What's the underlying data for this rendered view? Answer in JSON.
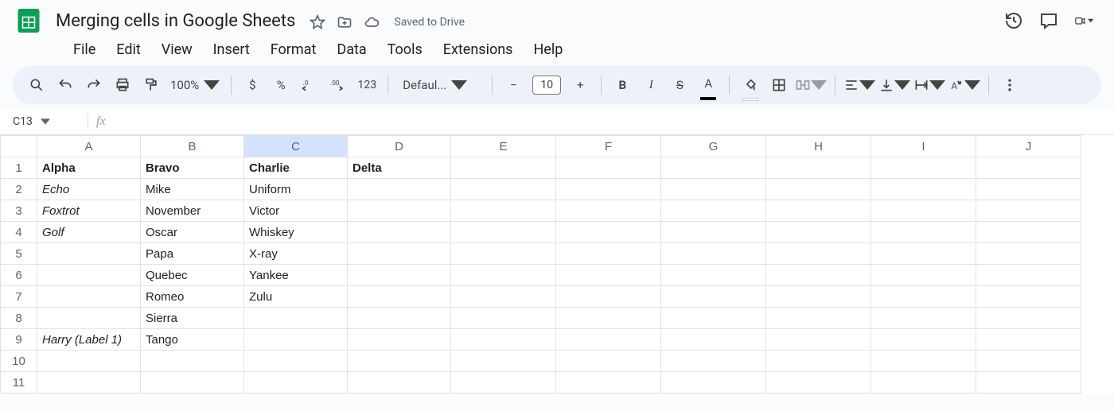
{
  "doc": {
    "title": "Merging cells in Google Sheets",
    "saved": "Saved to Drive"
  },
  "menu": {
    "file": "File",
    "edit": "Edit",
    "view": "View",
    "insert": "Insert",
    "format": "Format",
    "data": "Data",
    "tools": "Tools",
    "extensions": "Extensions",
    "help": "Help"
  },
  "toolbar": {
    "zoom": "100%",
    "currency": "$",
    "percent": "%",
    "decdec": ".0",
    "decinc": ".00",
    "num123": "123",
    "fontname": "Defaul...",
    "fontsize": "10",
    "bold": "B",
    "italic": "I",
    "strike": "S",
    "textcolor": "A",
    "fillcolor": "fill"
  },
  "namebox": {
    "ref": "C13",
    "fx": "fx"
  },
  "cols": [
    "A",
    "B",
    "C",
    "D",
    "E",
    "F",
    "G",
    "H",
    "I",
    "J"
  ],
  "rows": [
    "1",
    "2",
    "3",
    "4",
    "5",
    "6",
    "7",
    "8",
    "9",
    "10",
    "11"
  ],
  "cells": {
    "A1": "Alpha",
    "B1": "Bravo",
    "C1": "Charlie",
    "D1": "Delta",
    "A2": "Echo",
    "B2": "Mike",
    "C2": "Uniform",
    "A3": "Foxtrot",
    "B3": "November",
    "C3": "Victor",
    "A4": "Golf",
    "B4": "Oscar",
    "C4": "Whiskey",
    "B5": "Papa",
    "C5": "X-ray",
    "B6": "Quebec",
    "C6": "Yankee",
    "B7": "Romeo",
    "C7": "Zulu",
    "B8": "Sierra",
    "A9": "Harry (Label 1)",
    "B9": "Tango"
  },
  "active_col": "C"
}
